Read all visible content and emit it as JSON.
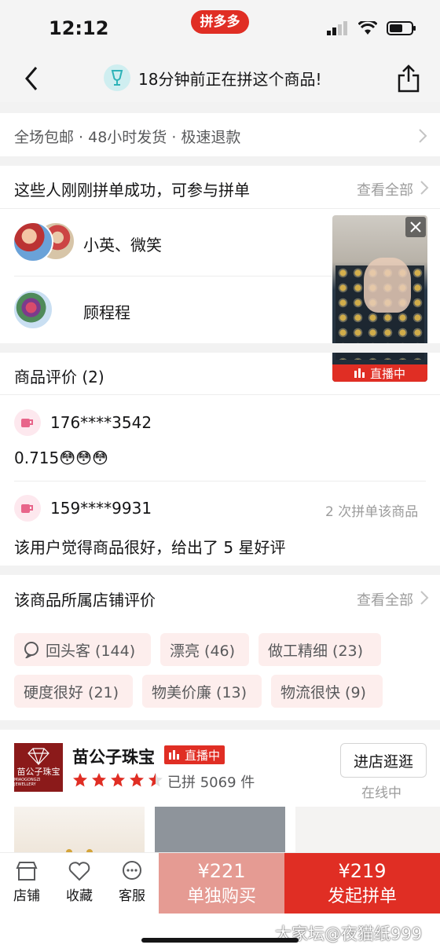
{
  "status": {
    "time": "12:12",
    "app_name": "拼多多"
  },
  "nav": {
    "notice": "18分钟前正在拼这个商品!"
  },
  "service": {
    "items": "全场包邮 · 48小时发货 · 极速退款"
  },
  "group_buy": {
    "title": "这些人刚刚拼单成功，可参与拼单",
    "view_all": "查看全部",
    "users": [
      {
        "names": "小英、微笑"
      },
      {
        "names": "顾程程"
      }
    ]
  },
  "live_card": {
    "badge": "直播中"
  },
  "reviews": {
    "title": "商品评价 (2)",
    "items": [
      {
        "user": "176****3542",
        "text": "0.715😳😳😳",
        "extra": ""
      },
      {
        "user": "159****9931",
        "text": "该用户觉得商品很好，给出了 5 星好评",
        "extra": "2 次拼单该商品"
      }
    ]
  },
  "store_reviews": {
    "title": "该商品所属店铺评价",
    "view_all": "查看全部",
    "tags": [
      {
        "label": "回头客 (144)",
        "icon": "chat-bubble-icon"
      },
      {
        "label": "漂亮 (46)"
      },
      {
        "label": "做工精细 (23)"
      },
      {
        "label": "硬度很好 (21)"
      },
      {
        "label": "物美价廉 (13)"
      },
      {
        "label": "物流很快 (9)"
      }
    ]
  },
  "store": {
    "logo_text": "苗公子珠宝",
    "logo_sub": "MIAOGONGZI JEWELLERY",
    "name": "苗公子珠宝",
    "live": "直播中",
    "rating": 4.5,
    "sold": "已拼 5069 件",
    "enter": "进店逛逛",
    "online": "在线中"
  },
  "bottom": {
    "tabs": [
      {
        "label": "店铺",
        "icon": "store-icon"
      },
      {
        "label": "收藏",
        "icon": "heart-icon"
      },
      {
        "label": "客服",
        "icon": "chat-icon"
      }
    ],
    "single_price": "¥221",
    "single_label": "单独购买",
    "group_price": "¥219",
    "group_label": "发起拼单"
  },
  "watermark": "大家坛@夜猫纸999",
  "colors": {
    "brand": "#e02e24",
    "single": "#e59b93"
  }
}
